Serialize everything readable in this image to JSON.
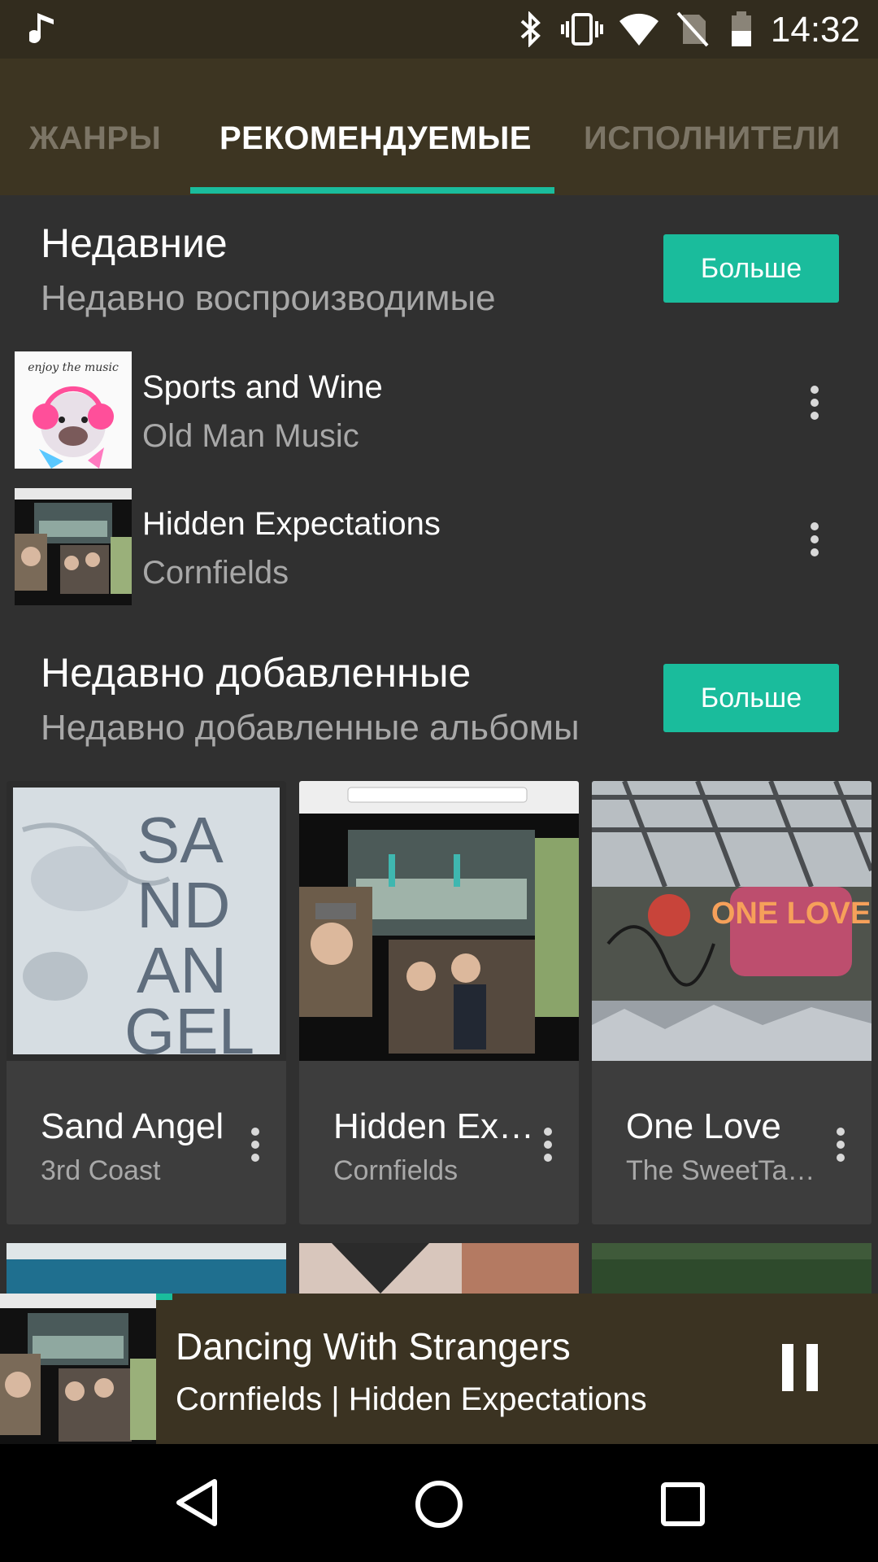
{
  "status_bar": {
    "time": "14:32",
    "icons": [
      "music-note-icon",
      "bluetooth-icon",
      "vibrate-icon",
      "wifi-icon",
      "no-sim-icon",
      "battery-icon"
    ]
  },
  "tabs": [
    {
      "label": "ЖАНРЫ",
      "active": false
    },
    {
      "label": "РЕКОМЕНДУЕМЫЕ",
      "active": true
    },
    {
      "label": "ИСПОЛНИТЕЛИ",
      "active": false
    }
  ],
  "recent": {
    "title": "Недавние",
    "subtitle": "Недавно воспроизводимые",
    "more_label": "Больше",
    "items": [
      {
        "title": "Sports and Wine",
        "artist": "Old Man Music"
      },
      {
        "title": "Hidden Expectations",
        "artist": "Cornfields"
      }
    ]
  },
  "added": {
    "title": "Недавно добавленные",
    "subtitle": "Недавно добавленные альбомы",
    "more_label": "Больше",
    "albums": [
      {
        "title": "Sand Angel",
        "artist": "3rd Coast"
      },
      {
        "title": "Hidden Ex…",
        "artist": "Cornfields"
      },
      {
        "title": "One Love",
        "artist": "The SweetTa…"
      }
    ],
    "art_text": {
      "sand_angel": [
        "SA",
        "ND",
        "AN",
        "GEL"
      ],
      "one_love": "ONE LOVE",
      "thumb_music": "enjoy the music"
    }
  },
  "now_playing": {
    "title": "Dancing With Strangers",
    "subtitle": "Cornfields | Hidden Expectations",
    "state": "playing"
  },
  "colors": {
    "accent": "#1abc9c",
    "header": "#3d3522",
    "background": "#303030",
    "now_playing": "#3b3322"
  }
}
